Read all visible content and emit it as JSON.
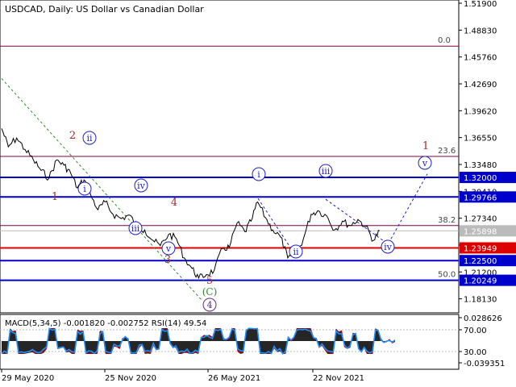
{
  "title": "USDCAD, Daily:  US Dollar vs Canadian Dollar",
  "colors": {
    "price": "#000000",
    "level_blue": "#0000cc",
    "level_red": "#dd0000",
    "fib": "#800040",
    "wave_red": "#a52a2a",
    "wave_blue": "#1f1fc8",
    "macd_hist": "#000000",
    "macd_signal": "#cc0000",
    "rsi": "#1e90ff"
  },
  "chart_data": {
    "type": "line",
    "symbol": "USDCAD",
    "timeframe": "Daily",
    "x_ticks": [
      "29 May 2020",
      "25 Nov 2020",
      "26 May 2021",
      "22 Nov 2021"
    ],
    "y_ticks": [
      "1.51900",
      "1.48830",
      "1.45760",
      "1.42690",
      "1.39620",
      "1.36550",
      "1.33480",
      "1.30410",
      "1.27340",
      "1.24270",
      "1.21200",
      "1.18130"
    ],
    "ylim": [
      1.169,
      1.519
    ],
    "series": [
      {
        "x": [
          "2020-05-29",
          "2020-06-10",
          "2020-06-25",
          "2020-07-10",
          "2020-07-25",
          "2020-08-08",
          "2020-08-22",
          "2020-09-05",
          "2020-09-18",
          "2020-09-30",
          "2020-10-12",
          "2020-10-24",
          "2020-11-05",
          "2020-11-18",
          "2020-12-01",
          "2020-12-15",
          "2020-12-30",
          "2021-01-13",
          "2021-01-28",
          "2021-02-10",
          "2021-02-25",
          "2021-03-10",
          "2021-03-25",
          "2021-04-08",
          "2021-04-22",
          "2021-05-06",
          "2021-05-18",
          "2021-06-01",
          "2021-06-15",
          "2021-06-30",
          "2021-07-12",
          "2021-07-26",
          "2021-08-09",
          "2021-08-20",
          "2021-09-01",
          "2021-09-15",
          "2021-09-28",
          "2021-10-12",
          "2021-10-25",
          "2021-11-08",
          "2021-11-22",
          "2021-12-06",
          "2021-12-18",
          "2022-01-03",
          "2022-01-17",
          "2022-01-31",
          "2022-02-14",
          "2022-02-28",
          "2022-03-14",
          "2022-03-28",
          "2022-04-08"
        ],
        "values": [
          1.376,
          1.355,
          1.365,
          1.352,
          1.34,
          1.328,
          1.319,
          1.34,
          1.334,
          1.325,
          1.308,
          1.317,
          1.3,
          1.283,
          1.292,
          1.278,
          1.273,
          1.277,
          1.264,
          1.26,
          1.248,
          1.242,
          1.255,
          1.25,
          1.228,
          1.216,
          1.205,
          1.209,
          1.214,
          1.239,
          1.24,
          1.268,
          1.258,
          1.27,
          1.292,
          1.274,
          1.26,
          1.252,
          1.228,
          1.23,
          1.25,
          1.278,
          1.282,
          1.276,
          1.26,
          1.27,
          1.265,
          1.272,
          1.264,
          1.248,
          1.259
        ]
      }
    ],
    "levels": [
      {
        "label": "1.32000",
        "value": 1.32,
        "color": "#0000cc",
        "tag": true
      },
      {
        "label": "1.29766",
        "value": 1.29766,
        "color": "#0000cc",
        "tag": true
      },
      {
        "label": "1.25898",
        "value": 1.25898,
        "color": "#bbbbbb",
        "tag": true
      },
      {
        "label": "1.23949",
        "value": 1.23949,
        "color": "#dd0000",
        "tag": true
      },
      {
        "label": "1.22500",
        "value": 1.225,
        "color": "#0000cc",
        "tag": true
      },
      {
        "label": "1.20249",
        "value": 1.20249,
        "color": "#0000cc",
        "tag": true
      }
    ],
    "fib_levels": [
      {
        "label": "0.0",
        "value": 1.47
      },
      {
        "label": "23.6",
        "value": 1.344
      },
      {
        "label": "38.2",
        "value": 1.265
      },
      {
        "label": "50.0",
        "value": 1.2025
      }
    ],
    "wave_labels_red": [
      "2",
      "1",
      "4",
      "3",
      "5",
      "1"
    ],
    "wave_labels_blue": [
      "ii",
      "i",
      "iv",
      "iii",
      "v",
      "i",
      "iii",
      "ii",
      "iv",
      "v"
    ],
    "wave_labels_green": [
      "C"
    ],
    "wave_labels_purple": [
      "4"
    ],
    "indicator": {
      "label": "MACD(5,34,5) -0.001820 -0.002752 RSI(14) 49.54",
      "y_ticks": [
        "0.028626",
        "70.00",
        "30.00",
        "-0.039351"
      ]
    }
  }
}
